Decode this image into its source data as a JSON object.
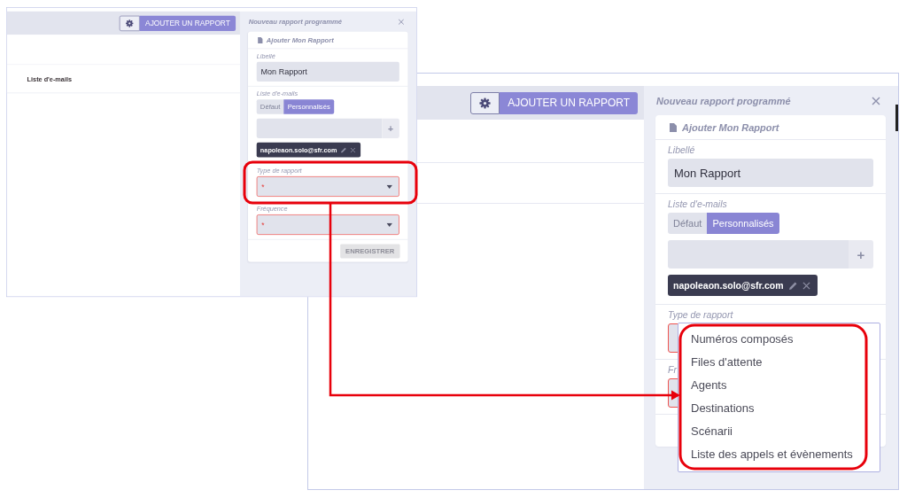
{
  "screenshots": [
    {
      "scrollbar": false,
      "toolbar": {
        "add_button": "AJOUTER UN RAPPORT"
      },
      "rows": [
        {
          "kind": "blank"
        },
        {
          "kind": "text",
          "label": "Liste d'e-mails"
        }
      ],
      "panel": {
        "title": "Nouveau rapport programmé",
        "card_title": "Ajouter Mon Rapport",
        "fields": [
          {
            "kind": "text",
            "label": "Libellé",
            "value": "Mon Rapport"
          },
          {
            "kind": "emails",
            "label": "Liste d'e-mails",
            "modes": [
              {
                "label": "Défaut",
                "selected": false
              },
              {
                "label": "Personnalisés",
                "selected": true
              }
            ],
            "add_button": "+",
            "chips": [
              {
                "email": "napoleaon.solo@sfr.com"
              }
            ]
          },
          {
            "kind": "select",
            "label": "Type de rapport",
            "required_mark": "*",
            "invalid": true,
            "caret": true,
            "open": false
          },
          {
            "kind": "select",
            "label": "Fréquence",
            "required_mark": "*",
            "invalid": true,
            "caret": true,
            "open": false
          }
        ],
        "save_button": {
          "label": "ENREGISTRER",
          "disabled": true
        }
      }
    },
    {
      "scrollbar": true,
      "toolbar": {
        "add_button": "AJOUTER UN RAPPORT"
      },
      "rows": [
        {
          "kind": "blank"
        },
        {
          "kind": "blank"
        }
      ],
      "panel": {
        "title": "Nouveau rapport programmé",
        "card_title": "Ajouter Mon Rapport",
        "fields": [
          {
            "kind": "text",
            "label": "Libellé",
            "value": "Mon Rapport"
          },
          {
            "kind": "emails",
            "label": "Liste d'e-mails",
            "modes": [
              {
                "label": "Défaut",
                "selected": false
              },
              {
                "label": "Personnalisés",
                "selected": true
              }
            ],
            "add_button": "+",
            "chips": [
              {
                "email": "napoleaon.solo@sfr.com"
              }
            ]
          },
          {
            "kind": "select",
            "label": "Type de rapport",
            "invalid": true,
            "open": true,
            "options": [
              "Numéros composés",
              "Files d'attente",
              "Agents",
              "Destinations",
              "Scénarii",
              "Liste des appels et évènements"
            ]
          },
          {
            "kind": "select",
            "label": "Fr",
            "invalid": true,
            "open": false
          }
        ]
      }
    }
  ],
  "annotations": [
    {
      "kind": "frame"
    },
    {
      "kind": "arrow"
    },
    {
      "kind": "frame"
    }
  ]
}
